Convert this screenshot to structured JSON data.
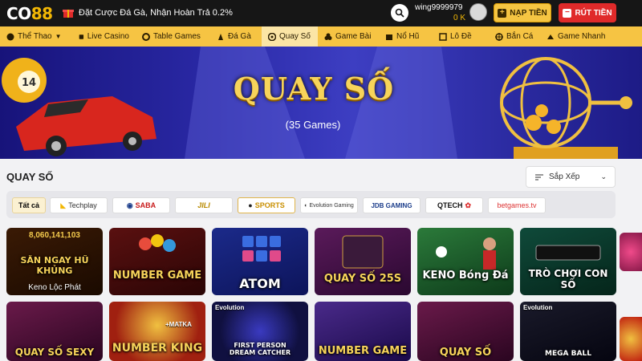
{
  "header": {
    "logo": "CO88",
    "promo_text": "Đặt Cược Đá Gà, Nhận Hoàn Trả 0.2%",
    "username": "wing9999979",
    "balance": "0 K",
    "deposit_label": "NẠP TIỀN",
    "withdraw_label": "RÚT TIỀN",
    "icons": {
      "gift": "gift-icon",
      "search": "search-icon",
      "deposit": "plus-icon",
      "withdraw": "minus-icon"
    }
  },
  "nav": {
    "items": [
      {
        "label": "Thể Thao",
        "icon": "sports-icon"
      },
      {
        "label": "Live Casino",
        "icon": "live-casino-icon"
      },
      {
        "label": "Table Games",
        "icon": "table-games-icon"
      },
      {
        "label": "Đá Gà",
        "icon": "rooster-icon"
      },
      {
        "label": "Quay Số",
        "icon": "lottery-icon"
      },
      {
        "label": "Game Bài",
        "icon": "cards-icon"
      },
      {
        "label": "Nổ Hũ",
        "icon": "slot-icon"
      },
      {
        "label": "Lô Đề",
        "icon": "lotto-icon"
      },
      {
        "label": "Bắn Cá",
        "icon": "fish-icon"
      },
      {
        "label": "Game Nhanh",
        "icon": "fast-game-icon"
      }
    ],
    "active_index": 4
  },
  "banner": {
    "title": "QUAY SỐ",
    "subtitle": "(35 Games)"
  },
  "section": {
    "title": "QUAY SỐ",
    "sort_label": "Sắp Xếp"
  },
  "providers": {
    "items": [
      "Tất cả",
      "Techplay",
      "SABA",
      "JILI",
      "SPORTS",
      "Evolution Gaming",
      "JDB GAMING",
      "QTECH",
      "betgames.tv"
    ],
    "active_index": 0
  },
  "games": {
    "row1": [
      {
        "title": "SĂN NGAY HŨ KHỦNG",
        "caption": "Keno Lộc Phát",
        "jackpot": "8,060,141,103"
      },
      {
        "title": "NUMBER GAME",
        "caption": ""
      },
      {
        "title": "ATOM",
        "caption": ""
      },
      {
        "title": "QUAY SỐ 25S",
        "caption": ""
      },
      {
        "title": "KENO Bóng Đá",
        "caption": ""
      },
      {
        "title": "TRÒ CHƠI CON SỐ",
        "caption": ""
      }
    ],
    "row2": [
      {
        "title": "QUAY SỐ SEXY",
        "badge": ""
      },
      {
        "title": "NUMBER KING",
        "badge": "+MATKA"
      },
      {
        "title": "FIRST PERSON DREAM CATCHER",
        "badge": "Evolution"
      },
      {
        "title": "NUMBER GAME",
        "badge": ""
      },
      {
        "title": "QUAY SỐ",
        "badge": ""
      },
      {
        "title": "MEGA BALL",
        "badge": "Evolution"
      }
    ]
  },
  "colors": {
    "topbar": "#161616",
    "nav": "#f6c443",
    "accent_gold": "#f2b705",
    "withdraw_red": "#e02a2a"
  }
}
